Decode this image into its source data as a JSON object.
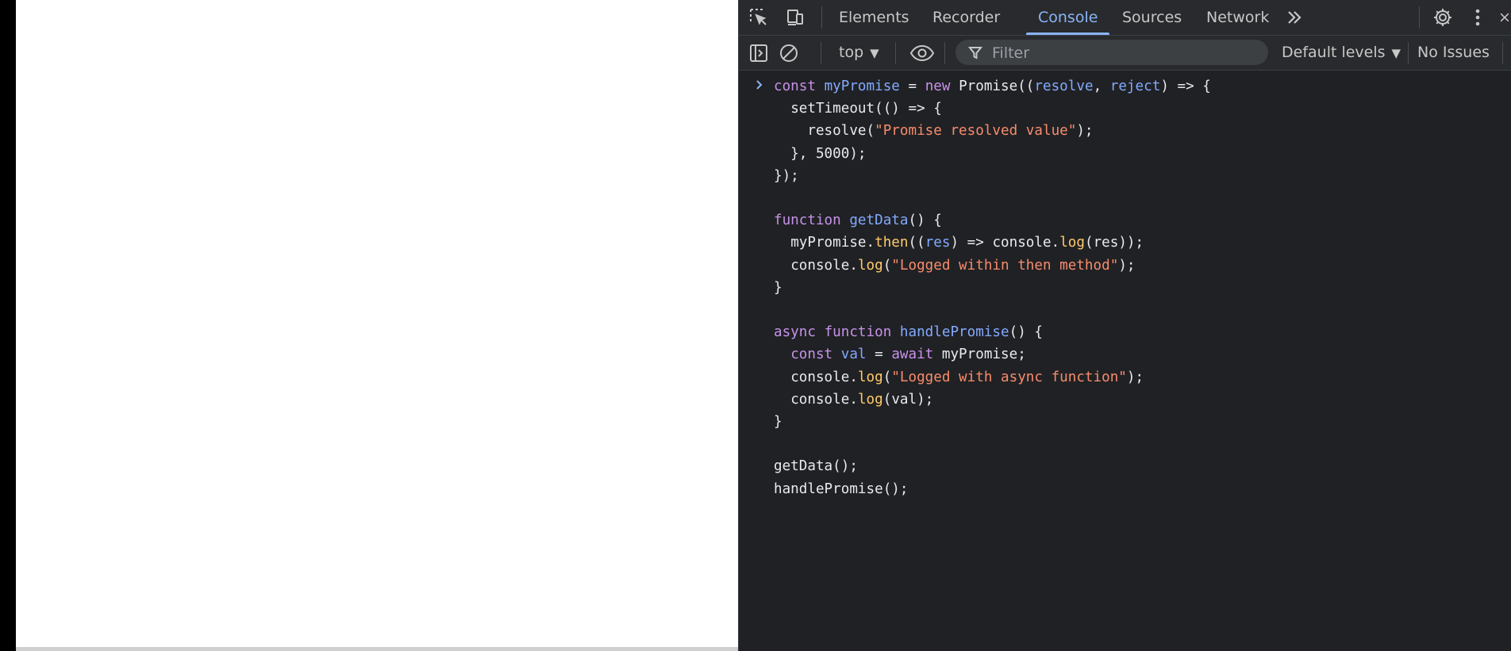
{
  "devtools": {
    "tabs": [
      {
        "label": "Elements",
        "active": false
      },
      {
        "label": "Recorder",
        "active": false
      },
      {
        "label": "Console",
        "active": true
      },
      {
        "label": "Sources",
        "active": false
      },
      {
        "label": "Network",
        "active": false
      }
    ],
    "icons": {
      "inspect": "inspect-element-icon",
      "device": "device-toolbar-icon",
      "more_tabs": "double-chevron-right-icon",
      "settings": "gear-icon",
      "menu": "kebab-menu-icon",
      "sidebar": "sidebar-toggle-icon",
      "clear": "clear-console-icon",
      "eye": "live-expression-eye-icon",
      "filter": "filter-funnel-icon",
      "prompt": "chevron-right-icon"
    },
    "colors": {
      "accent": "#8ab4f8",
      "panel_bg": "#202124",
      "toolbar_bg": "#292a2d"
    }
  },
  "console_toolbar": {
    "context": "top",
    "filter_placeholder": "Filter",
    "levels": "Default levels",
    "issues": "No Issues"
  },
  "console": {
    "input_lines": [
      "const myPromise = new Promise((resolve, reject) => {",
      "  setTimeout(() => {",
      "    resolve(\"Promise resolved value\");",
      "  }, 5000);",
      "});",
      "",
      "function getData() {",
      "  myPromise.then((res) => console.log(res));",
      "  console.log(\"Logged within then method\");",
      "}",
      "",
      "async function handlePromise() {",
      "  const val = await myPromise;",
      "  console.log(\"Logged with async function\");",
      "  console.log(val);",
      "}",
      "",
      "getData();",
      "handlePromise();"
    ],
    "syntax_colors": {
      "keyword": "#c792ea",
      "definition": "#82aaff",
      "string": "#f78c6c",
      "method": "#ffcb6b",
      "text": "#e8eaed"
    }
  }
}
